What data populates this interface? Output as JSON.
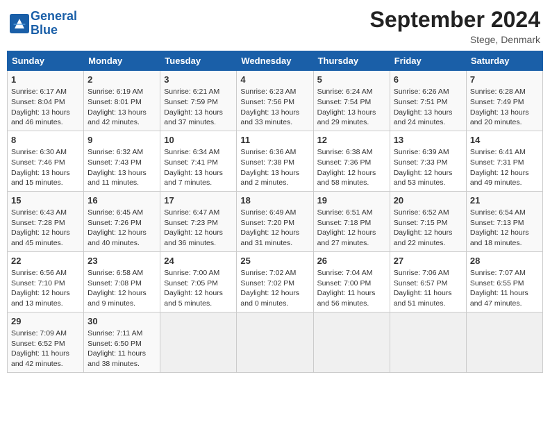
{
  "header": {
    "logo_line1": "General",
    "logo_line2": "Blue",
    "month_title": "September 2024",
    "location": "Stege, Denmark"
  },
  "weekdays": [
    "Sunday",
    "Monday",
    "Tuesday",
    "Wednesday",
    "Thursday",
    "Friday",
    "Saturday"
  ],
  "weeks": [
    [
      {
        "day": "1",
        "info": "Sunrise: 6:17 AM\nSunset: 8:04 PM\nDaylight: 13 hours\nand 46 minutes."
      },
      {
        "day": "2",
        "info": "Sunrise: 6:19 AM\nSunset: 8:01 PM\nDaylight: 13 hours\nand 42 minutes."
      },
      {
        "day": "3",
        "info": "Sunrise: 6:21 AM\nSunset: 7:59 PM\nDaylight: 13 hours\nand 37 minutes."
      },
      {
        "day": "4",
        "info": "Sunrise: 6:23 AM\nSunset: 7:56 PM\nDaylight: 13 hours\nand 33 minutes."
      },
      {
        "day": "5",
        "info": "Sunrise: 6:24 AM\nSunset: 7:54 PM\nDaylight: 13 hours\nand 29 minutes."
      },
      {
        "day": "6",
        "info": "Sunrise: 6:26 AM\nSunset: 7:51 PM\nDaylight: 13 hours\nand 24 minutes."
      },
      {
        "day": "7",
        "info": "Sunrise: 6:28 AM\nSunset: 7:49 PM\nDaylight: 13 hours\nand 20 minutes."
      }
    ],
    [
      {
        "day": "8",
        "info": "Sunrise: 6:30 AM\nSunset: 7:46 PM\nDaylight: 13 hours\nand 15 minutes."
      },
      {
        "day": "9",
        "info": "Sunrise: 6:32 AM\nSunset: 7:43 PM\nDaylight: 13 hours\nand 11 minutes."
      },
      {
        "day": "10",
        "info": "Sunrise: 6:34 AM\nSunset: 7:41 PM\nDaylight: 13 hours\nand 7 minutes."
      },
      {
        "day": "11",
        "info": "Sunrise: 6:36 AM\nSunset: 7:38 PM\nDaylight: 13 hours\nand 2 minutes."
      },
      {
        "day": "12",
        "info": "Sunrise: 6:38 AM\nSunset: 7:36 PM\nDaylight: 12 hours\nand 58 minutes."
      },
      {
        "day": "13",
        "info": "Sunrise: 6:39 AM\nSunset: 7:33 PM\nDaylight: 12 hours\nand 53 minutes."
      },
      {
        "day": "14",
        "info": "Sunrise: 6:41 AM\nSunset: 7:31 PM\nDaylight: 12 hours\nand 49 minutes."
      }
    ],
    [
      {
        "day": "15",
        "info": "Sunrise: 6:43 AM\nSunset: 7:28 PM\nDaylight: 12 hours\nand 45 minutes."
      },
      {
        "day": "16",
        "info": "Sunrise: 6:45 AM\nSunset: 7:26 PM\nDaylight: 12 hours\nand 40 minutes."
      },
      {
        "day": "17",
        "info": "Sunrise: 6:47 AM\nSunset: 7:23 PM\nDaylight: 12 hours\nand 36 minutes."
      },
      {
        "day": "18",
        "info": "Sunrise: 6:49 AM\nSunset: 7:20 PM\nDaylight: 12 hours\nand 31 minutes."
      },
      {
        "day": "19",
        "info": "Sunrise: 6:51 AM\nSunset: 7:18 PM\nDaylight: 12 hours\nand 27 minutes."
      },
      {
        "day": "20",
        "info": "Sunrise: 6:52 AM\nSunset: 7:15 PM\nDaylight: 12 hours\nand 22 minutes."
      },
      {
        "day": "21",
        "info": "Sunrise: 6:54 AM\nSunset: 7:13 PM\nDaylight: 12 hours\nand 18 minutes."
      }
    ],
    [
      {
        "day": "22",
        "info": "Sunrise: 6:56 AM\nSunset: 7:10 PM\nDaylight: 12 hours\nand 13 minutes."
      },
      {
        "day": "23",
        "info": "Sunrise: 6:58 AM\nSunset: 7:08 PM\nDaylight: 12 hours\nand 9 minutes."
      },
      {
        "day": "24",
        "info": "Sunrise: 7:00 AM\nSunset: 7:05 PM\nDaylight: 12 hours\nand 5 minutes."
      },
      {
        "day": "25",
        "info": "Sunrise: 7:02 AM\nSunset: 7:02 PM\nDaylight: 12 hours\nand 0 minutes."
      },
      {
        "day": "26",
        "info": "Sunrise: 7:04 AM\nSunset: 7:00 PM\nDaylight: 11 hours\nand 56 minutes."
      },
      {
        "day": "27",
        "info": "Sunrise: 7:06 AM\nSunset: 6:57 PM\nDaylight: 11 hours\nand 51 minutes."
      },
      {
        "day": "28",
        "info": "Sunrise: 7:07 AM\nSunset: 6:55 PM\nDaylight: 11 hours\nand 47 minutes."
      }
    ],
    [
      {
        "day": "29",
        "info": "Sunrise: 7:09 AM\nSunset: 6:52 PM\nDaylight: 11 hours\nand 42 minutes."
      },
      {
        "day": "30",
        "info": "Sunrise: 7:11 AM\nSunset: 6:50 PM\nDaylight: 11 hours\nand 38 minutes."
      },
      {
        "day": "",
        "info": ""
      },
      {
        "day": "",
        "info": ""
      },
      {
        "day": "",
        "info": ""
      },
      {
        "day": "",
        "info": ""
      },
      {
        "day": "",
        "info": ""
      }
    ]
  ]
}
